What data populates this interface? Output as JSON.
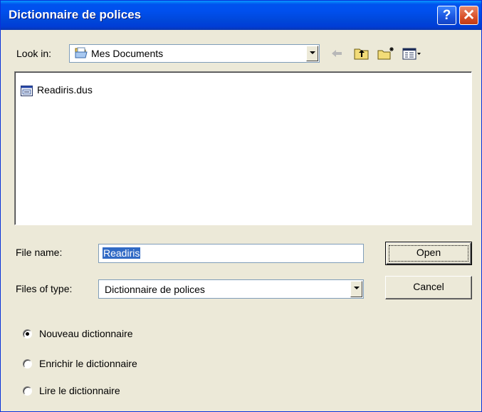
{
  "window": {
    "title": "Dictionnaire de polices",
    "help_label": "?",
    "close_label": "✕"
  },
  "lookin": {
    "label": "Look in:",
    "value": "Mes Documents",
    "folder_icon": "documents-folder-icon"
  },
  "toolbar": {
    "back_icon": "back-arrow-icon",
    "up_icon": "up-folder-icon",
    "new_folder_icon": "new-folder-icon",
    "views_icon": "views-menu-icon"
  },
  "files": [
    {
      "name": "Readiris.dus",
      "icon": "dictionary-file-icon"
    }
  ],
  "filename": {
    "label": "File name:",
    "value": "Readiris"
  },
  "filetype": {
    "label": "Files of type:",
    "value": "Dictionnaire de polices"
  },
  "buttons": {
    "open": "Open",
    "cancel": "Cancel"
  },
  "options": [
    {
      "label": "Nouveau dictionnaire",
      "checked": true
    },
    {
      "label": "Enrichir le dictionnaire",
      "checked": false
    },
    {
      "label": "Lire le dictionnaire",
      "checked": false
    }
  ],
  "colors": {
    "titlebar": "#0053ee",
    "dialog_bg": "#ece9d8",
    "selection": "#316ac5",
    "close_button": "#d9502a"
  }
}
